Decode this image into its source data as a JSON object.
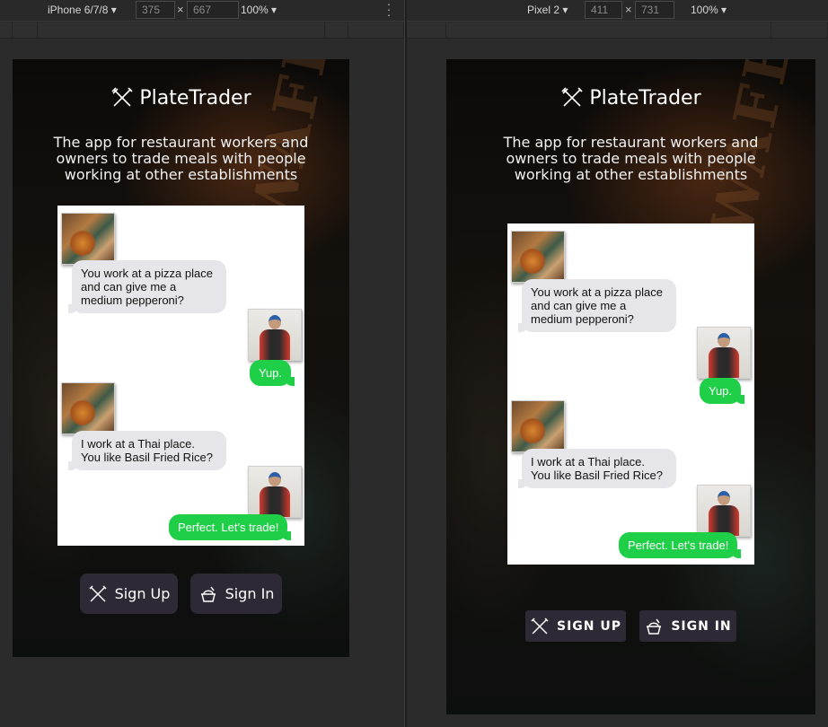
{
  "left_pane": {
    "device_select": "iPhone 6/7/8 ▾",
    "width": "375",
    "height": "667",
    "zoom": "100% ▾"
  },
  "right_pane": {
    "device_select": "Pixel 2 ▾",
    "width": "411",
    "height": "731",
    "zoom": "100% ▾"
  },
  "toolbar": {
    "dimension_separator": "×",
    "more_icon": "kebab-menu-icon"
  },
  "app": {
    "brand_name": "PlateTrader",
    "brand_icon": "crossed-fork-knife-icon",
    "tagline": "The app for restaurant workers and owners to trade meals with people working at other establishments",
    "messages": [
      {
        "side": "in",
        "avatar": "food-avatar",
        "text": "You work at a pizza place and can give me a medium pepperoni?"
      },
      {
        "side": "out",
        "avatar": "person-avatar",
        "text": "Yup."
      },
      {
        "side": "in",
        "avatar": "food-avatar",
        "text": "I work at a Thai place. You like Basil Fried Rice?"
      },
      {
        "side": "out",
        "avatar": "person-avatar",
        "text": "Perfect. Let's trade!"
      }
    ],
    "left_buttons": {
      "signup": "Sign Up",
      "signin": "Sign In"
    },
    "right_buttons": {
      "signup": "SIGN UP",
      "signin": "SIGN IN"
    }
  },
  "colors": {
    "bubble_out": "#1fcf47",
    "bubble_in": "#e6e6ea",
    "button_bg": "#2e2a35",
    "devtools_bg": "#2b2b2b"
  }
}
